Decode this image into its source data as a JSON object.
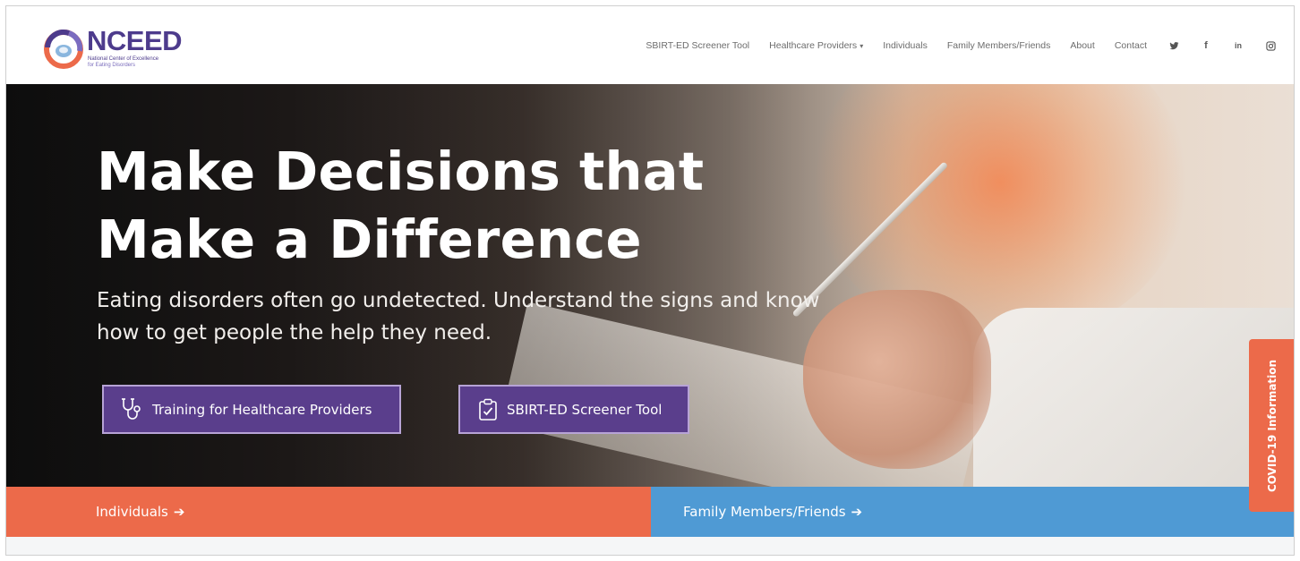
{
  "brand": {
    "name": "NCEED",
    "subtitle_line1": "National Center of Excellence",
    "subtitle_line2": "for Eating Disorders",
    "colors": {
      "purple": "#4d3b8c",
      "coral": "#ec6a4a",
      "blue": "#4f9ad4"
    }
  },
  "nav": {
    "items": [
      {
        "label": "SBIRT-ED Screener Tool"
      },
      {
        "label": "Healthcare Providers",
        "caret": "▾"
      },
      {
        "label": "Individuals"
      },
      {
        "label": "Family Members/Friends"
      },
      {
        "label": "About"
      },
      {
        "label": "Contact"
      }
    ],
    "social": [
      {
        "icon": "twitter-icon"
      },
      {
        "icon": "facebook-icon",
        "glyph": "f"
      },
      {
        "icon": "linkedin-icon",
        "glyph": "in"
      },
      {
        "icon": "instagram-icon"
      }
    ]
  },
  "hero": {
    "headline_line1": "Make Decisions that",
    "headline_line2": "Make a Difference",
    "subline": "Eating disorders often go undetected. Understand the signs and know how to get people the help they need.",
    "buttons": [
      {
        "label": "Training for Healthcare Providers",
        "icon": "stethoscope-icon"
      },
      {
        "label": "SBIRT-ED Screener Tool",
        "icon": "clipboard-check-icon"
      }
    ]
  },
  "bars": {
    "individuals": "Individuals",
    "family": "Family Members/Friends",
    "arrow": "➔"
  },
  "covid_tab": {
    "label": "COVID-19 Information"
  }
}
